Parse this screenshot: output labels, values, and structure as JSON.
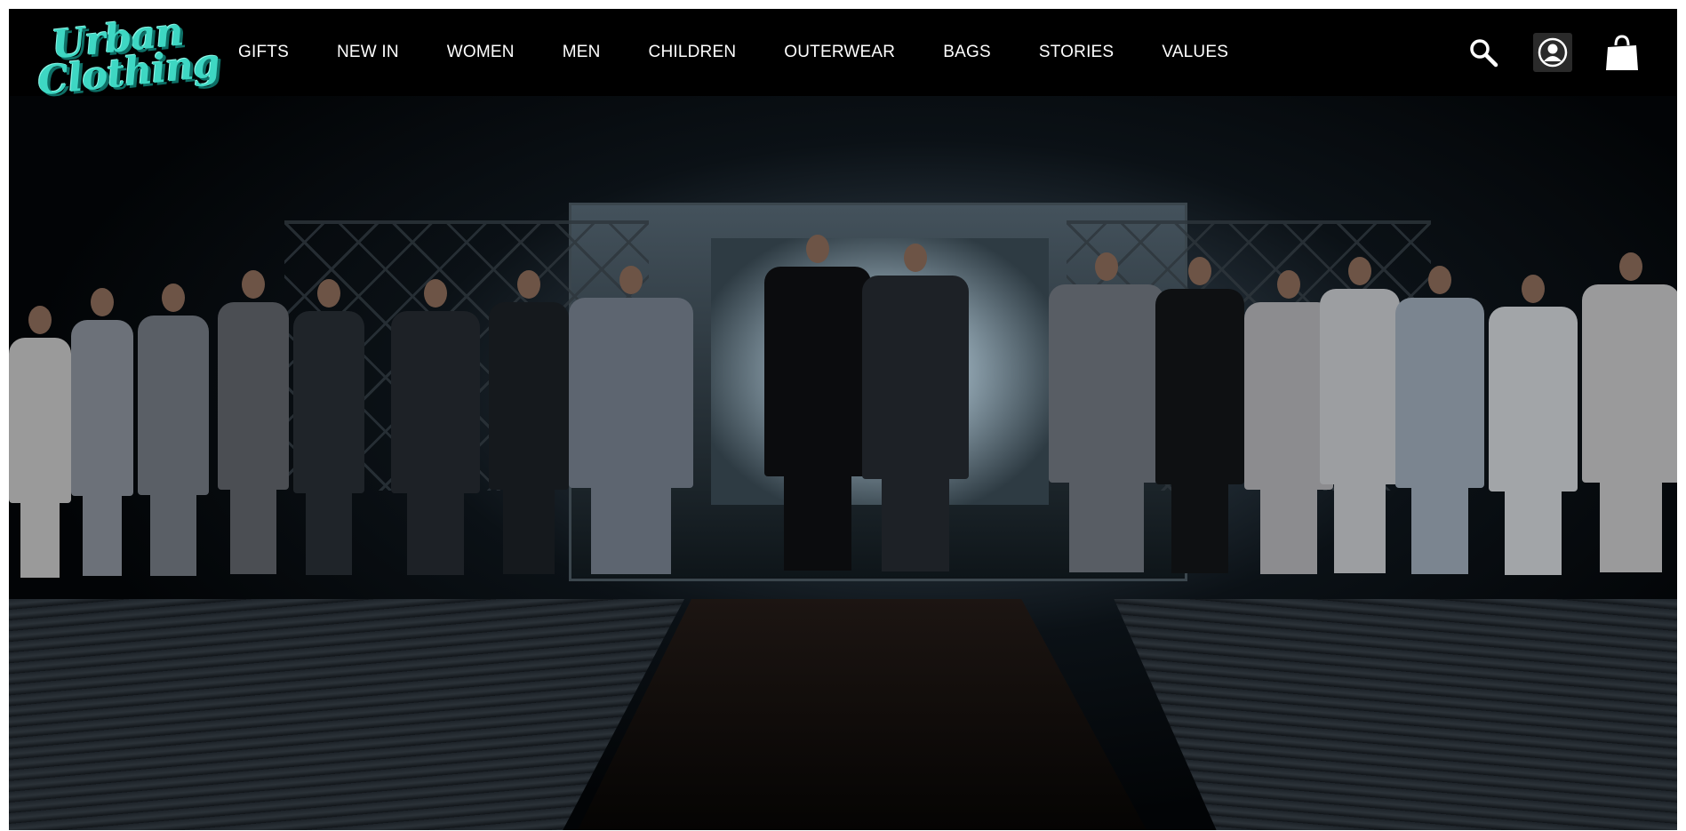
{
  "brand": {
    "logo_line1": "Urban",
    "logo_line2": "Clothing",
    "accent_color": "#3ed7c3"
  },
  "nav": {
    "items": [
      {
        "label": "GIFTS"
      },
      {
        "label": "NEW IN"
      },
      {
        "label": "WOMEN"
      },
      {
        "label": "MEN"
      },
      {
        "label": "CHILDREN"
      },
      {
        "label": "OUTERWEAR"
      },
      {
        "label": "BAGS"
      },
      {
        "label": "STORIES"
      },
      {
        "label": "VALUES"
      }
    ]
  },
  "header_icons": [
    {
      "name": "search-icon"
    },
    {
      "name": "account-icon"
    },
    {
      "name": "shopping-bag-icon"
    }
  ],
  "hero": {
    "image": "runway-finale-photo"
  },
  "colors": {
    "header_bg": "#000000",
    "nav_text": "#ffffff"
  }
}
